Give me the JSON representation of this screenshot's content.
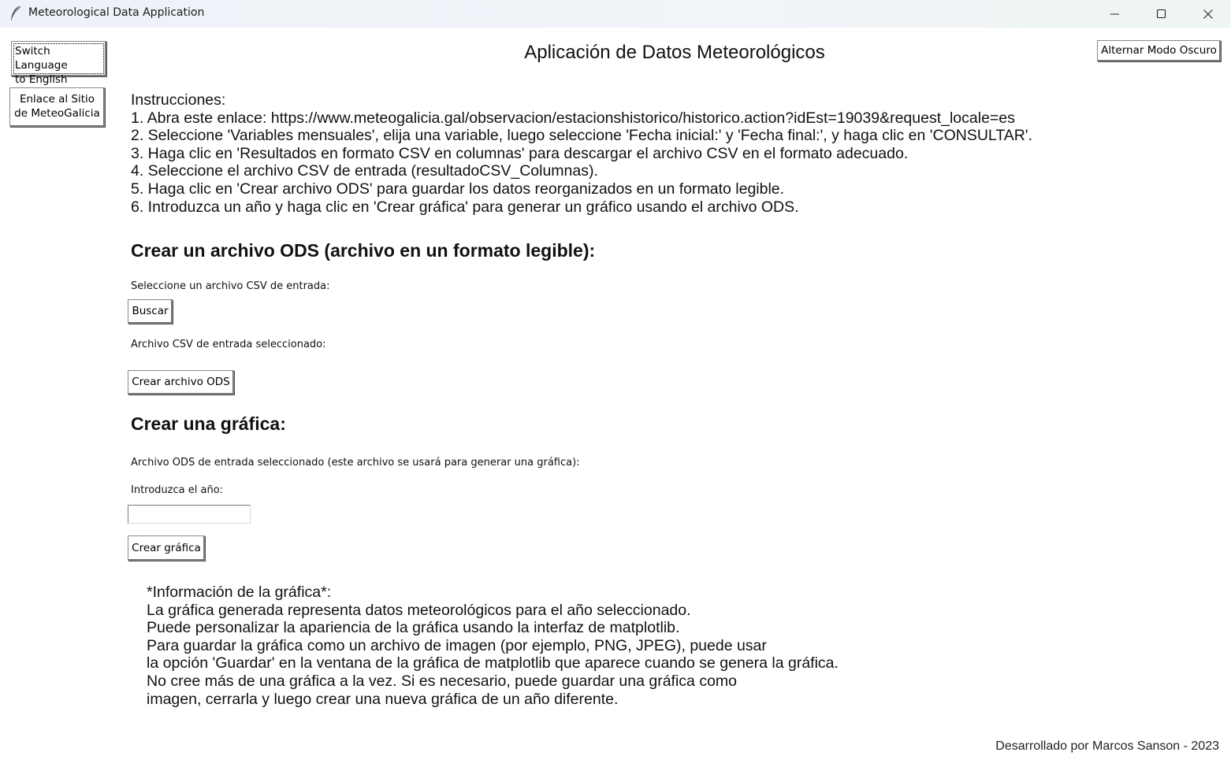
{
  "window": {
    "title": "Meteorological Data Application",
    "icon": "feather-icon",
    "controls": [
      "minimize-icon",
      "maximize-icon",
      "close-icon"
    ]
  },
  "header": {
    "title": "Aplicación de Datos Meteorológicos",
    "switch_language_line1": "Switch Language",
    "switch_language_line2": "to English",
    "meteogalicia_line1": "Enlace al Sitio",
    "meteogalicia_line2": "de MeteoGalicia",
    "dark_mode": "Alternar Modo Oscuro"
  },
  "instructions": {
    "lines": [
      "Instrucciones:",
      "1. Abra este enlace: https://www.meteogalicia.gal/observacion/estacionshistorico/historico.action?idEst=19039&request_locale=es",
      "2. Seleccione 'Variables mensuales', elija una variable, luego seleccione 'Fecha inicial:' y 'Fecha final:', y haga clic en 'CONSULTAR'.",
      "3. Haga clic en 'Resultados en formato CSV en columnas' para descargar el archivo CSV en el formato adecuado.",
      "4. Seleccione el archivo CSV de entrada (resultadoCSV_Columnas).",
      "5. Haga clic en 'Crear archivo ODS' para guardar los datos reorganizados en un formato legible.",
      "6. Introduzca un año y haga clic en 'Crear gráfica' para generar un gráfico usando el archivo ODS."
    ]
  },
  "ods_section": {
    "heading": "Crear un archivo ODS (archivo en un formato legible):",
    "select_label": "Seleccione un archivo CSV de entrada:",
    "browse_button": "Buscar",
    "selected_label": "Archivo CSV de entrada seleccionado:",
    "create_button": "Crear archivo ODS"
  },
  "graph_section": {
    "heading": "Crear una gráfica:",
    "ods_selected_label": "Archivo ODS de entrada seleccionado (este archivo se usará para generar una gráfica):",
    "year_label": "Introduzca el año:",
    "year_value": "",
    "create_button": "Crear gráfica"
  },
  "graph_info": {
    "lines": [
      "*Información de la gráfica*:",
      "La gráfica generada representa datos meteorológicos para el año seleccionado.",
      "Puede personalizar la apariencia de la gráfica usando la interfaz de matplotlib.",
      "Para guardar la gráfica como un archivo de imagen (por ejemplo, PNG, JPEG), puede usar",
      "la opción 'Guardar' en la ventana de la gráfica de matplotlib que aparece cuando se genera la gráfica.",
      "No cree más de una gráfica a la vez. Si es necesario, puede guardar una gráfica como",
      "imagen, cerrarla y luego crear una nueva gráfica de un año diferente."
    ]
  },
  "footer": {
    "credit": "Desarrollado por Marcos Sanson - 2023"
  }
}
